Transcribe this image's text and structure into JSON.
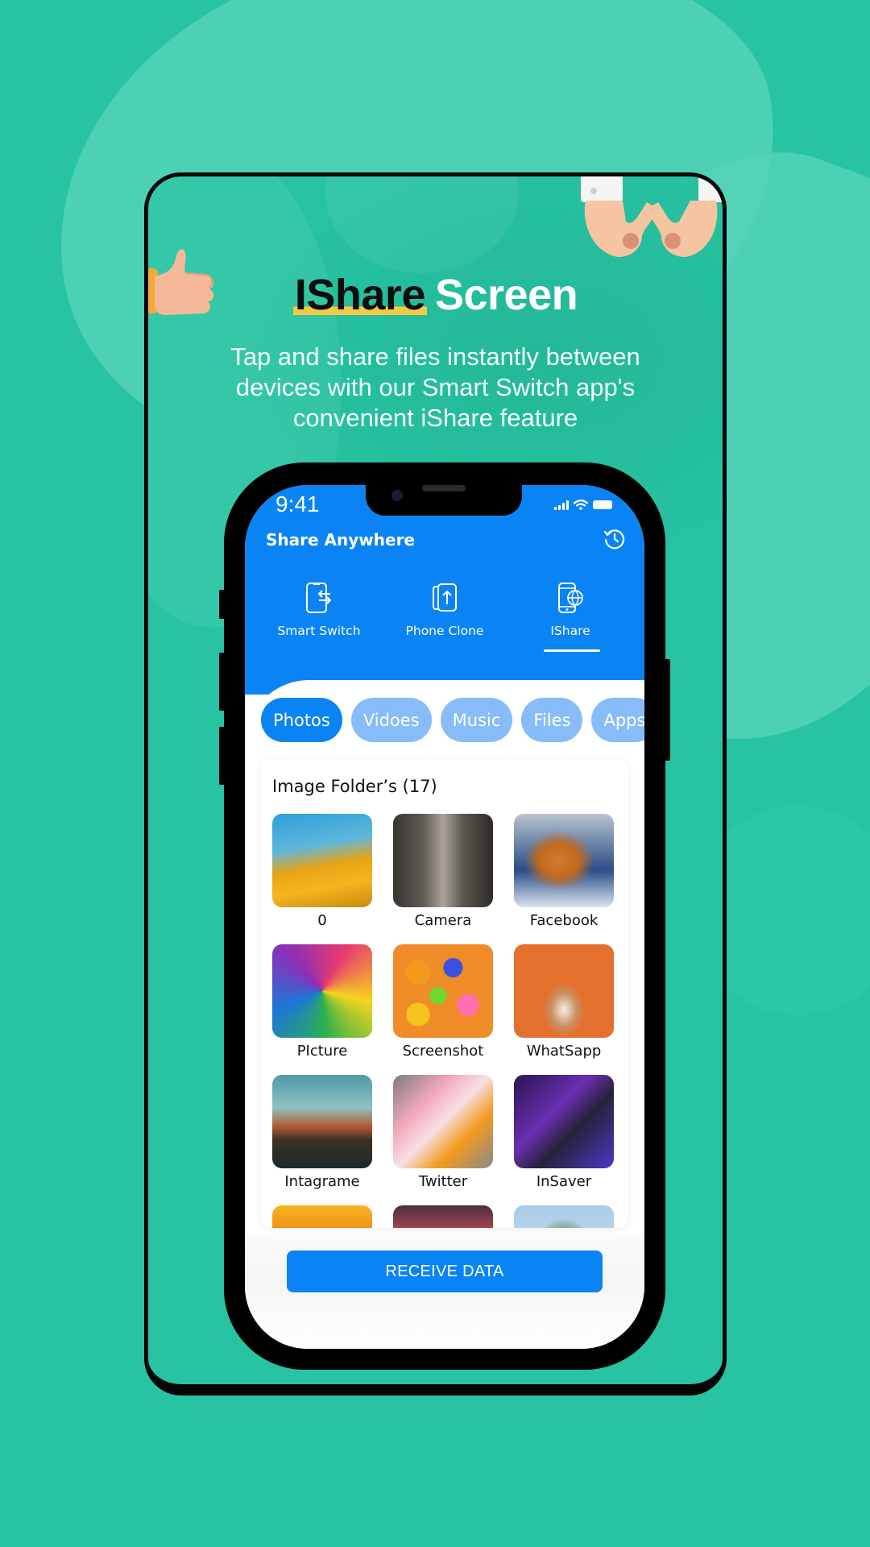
{
  "promo": {
    "headline_dark": "IShare",
    "headline_light": "Screen",
    "subtitle_lines": [
      "Tap and share files instantly between",
      "devices with our Smart Switch app's",
      "convenient iShare feature"
    ],
    "highlight_color": "#f5c944",
    "background_color": "#27c3a2"
  },
  "status_bar": {
    "time": "9:41",
    "icons": [
      "signal-icon",
      "wifi-icon",
      "battery-icon"
    ]
  },
  "app": {
    "title": "Share Anywhere",
    "history_icon": "history-icon",
    "accent_color": "#0a84f5",
    "mode_tabs": [
      {
        "label": "Smart Switch",
        "icon": "phone-transfer-icon",
        "active": false
      },
      {
        "label": "Phone Clone",
        "icon": "phone-clone-icon",
        "active": false
      },
      {
        "label": "IShare",
        "icon": "phone-globe-icon",
        "active": true
      }
    ],
    "category_chips": [
      {
        "label": "Photos",
        "active": true
      },
      {
        "label": "Vidoes",
        "active": false
      },
      {
        "label": "Music",
        "active": false
      },
      {
        "label": "Files",
        "active": false
      },
      {
        "label": "Apps",
        "active": false
      }
    ],
    "folders_title": "Image Folder’s (17)",
    "folders": [
      {
        "name": "0",
        "thumb": "yellow-flowers"
      },
      {
        "name": "Camera",
        "thumb": "rocky-beach"
      },
      {
        "name": "Facebook",
        "thumb": "fox-in-snow"
      },
      {
        "name": "PIcture",
        "thumb": "rainbow-roses"
      },
      {
        "name": "Screenshot",
        "thumb": "colorful-balls"
      },
      {
        "name": "WhatSapp",
        "thumb": "puppy-orange"
      },
      {
        "name": "Intagrame",
        "thumb": "mountain-sunset"
      },
      {
        "name": "Twitter",
        "thumb": "social-apps-phone"
      },
      {
        "name": "InSaver",
        "thumb": "person-laptop"
      },
      {
        "name": "",
        "thumb": "orange-sunset"
      },
      {
        "name": "",
        "thumb": "red-clouds"
      },
      {
        "name": "",
        "thumb": "green-tree"
      }
    ],
    "receive_button": "RECEIVE DATA"
  }
}
